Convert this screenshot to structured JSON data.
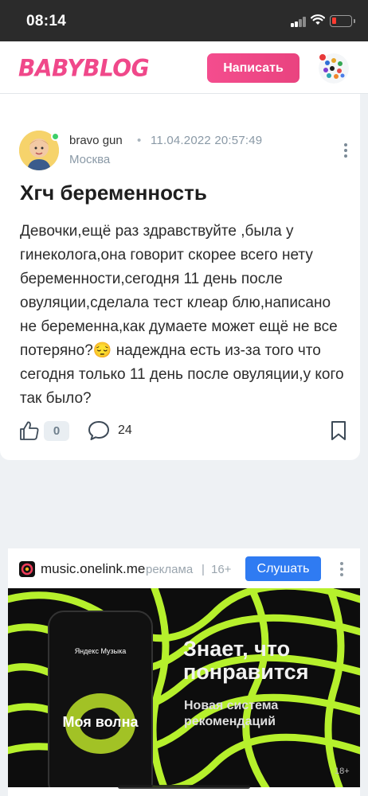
{
  "status_bar": {
    "time": "08:14",
    "battery_level": 0.15
  },
  "header": {
    "logo": "BABYBLOG",
    "write_button": "Написать"
  },
  "post": {
    "author": "bravo gun",
    "separator": "•",
    "date": "11.04.2022 20:57:49",
    "city": "Москва",
    "title": "Хгч беременность",
    "body": "Девочки,ещё раз здравствуйте ,была у гинеколога,она говорит скорее всего нету беременности,сегодня 11 день после овуляции,сделала тест клеар блю,написано не беременна,как думаете может ещё не все потеряно?😔 надеждна есть из-за того что сегодня только 11 день после овуляции,у кого так было?",
    "likes": "0",
    "comments": "24"
  },
  "ad": {
    "domain": "music.onelink.me",
    "label": "реклама",
    "bar": "|",
    "age": "16+",
    "button": "Слушать",
    "phone_brand": "Яндекс Музыка",
    "phone_title": "Моя волна",
    "headline": "Знает, что понравится",
    "subline": "Новая система рекомендаций",
    "rating": "18+",
    "accent_color": "#b6f02c"
  }
}
